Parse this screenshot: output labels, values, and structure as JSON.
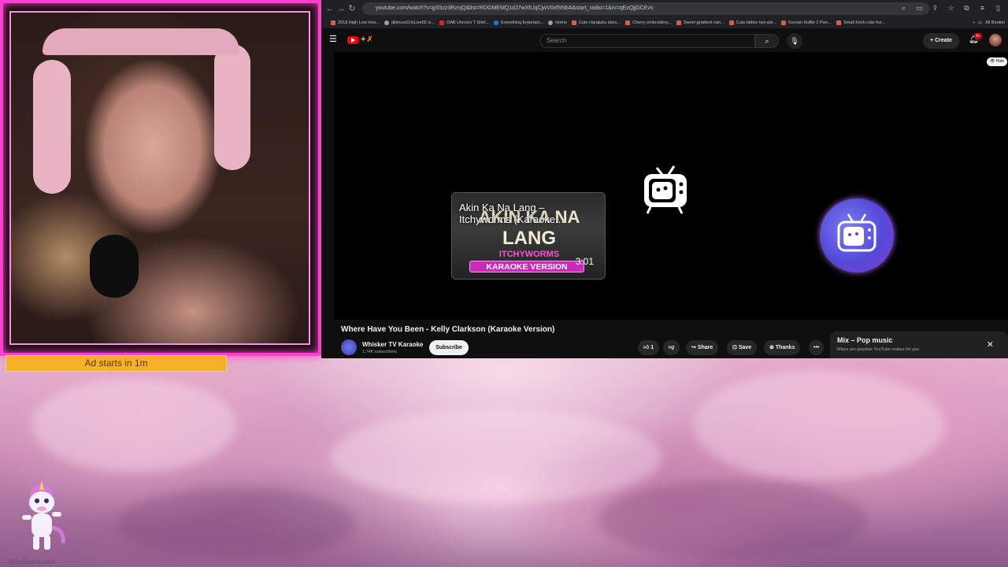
{
  "webcam_overlay": {
    "ad_bar_text": "Ad starts in  1m",
    "streamer_name": "MissSharonzard"
  },
  "browser": {
    "url": "youtube.com/watch?v=gS5zz3RznjQ&list=RDGMEMQ1dJ7wXfLlqCjwV0xfSNbA&start_radio=1&rv=qEzQjjGCEvs",
    "bookmarks": [
      {
        "label": "2018 High Low Hoo...",
        "icon": "red"
      },
      {
        "label": "djdeuceDJsLive55 vi...",
        "icon": "globe"
      },
      {
        "label": "OAB Unicorn T Shirt...",
        "icon": "youtube"
      },
      {
        "label": "Everything Entertain...",
        "icon": "facebook"
      },
      {
        "label": "Home",
        "icon": "globe"
      },
      {
        "label": "Cute Harajuku stars...",
        "icon": "red"
      },
      {
        "label": "Cherry embroidery...",
        "icon": "red"
      },
      {
        "label": "Sweet gradient rain...",
        "icon": "red"
      },
      {
        "label": "Cute lattice two-pie...",
        "icon": "red"
      },
      {
        "label": "Korean Ruffle 2 Piec...",
        "icon": "red"
      },
      {
        "label": "Small fresh cute fox...",
        "icon": "red"
      }
    ],
    "all_bookmarks_label": "All Bookm"
  },
  "youtube": {
    "search_placeholder": "Search",
    "create_label": "Create",
    "notification_count": "9+",
    "hide_label": "Hide",
    "video": {
      "title": "Where Have You Been - Kelly Clarkson (Karaoke Version)",
      "channel_name": "Whisker TV Karaoke",
      "subscribers": "1.74K subscribers",
      "subscribe_label": "Subscribe",
      "like_count": "1",
      "share_label": "Share",
      "save_label": "Save",
      "thanks_label": "Thanks"
    },
    "up_next_thumb": {
      "title": "Akin Ka Na Lang – Itchyworms (Karaoke...",
      "big_text_line1": "AKIN KA NA",
      "big_text_line2": "LANG",
      "artist": "ITCHYWORMS",
      "karaoke_label": "KARAOKE VERSION",
      "duration": "3:01"
    },
    "mix_panel": {
      "title": "Mix – Pop music",
      "subtitle": "Mixes are playlists YouTube makes for you"
    }
  },
  "colors": {
    "frame_pink": "#ff3fd0",
    "ad_bar": "#f6b127",
    "youtube_red": "#ff0000",
    "channel_purple": "#5448d8"
  }
}
